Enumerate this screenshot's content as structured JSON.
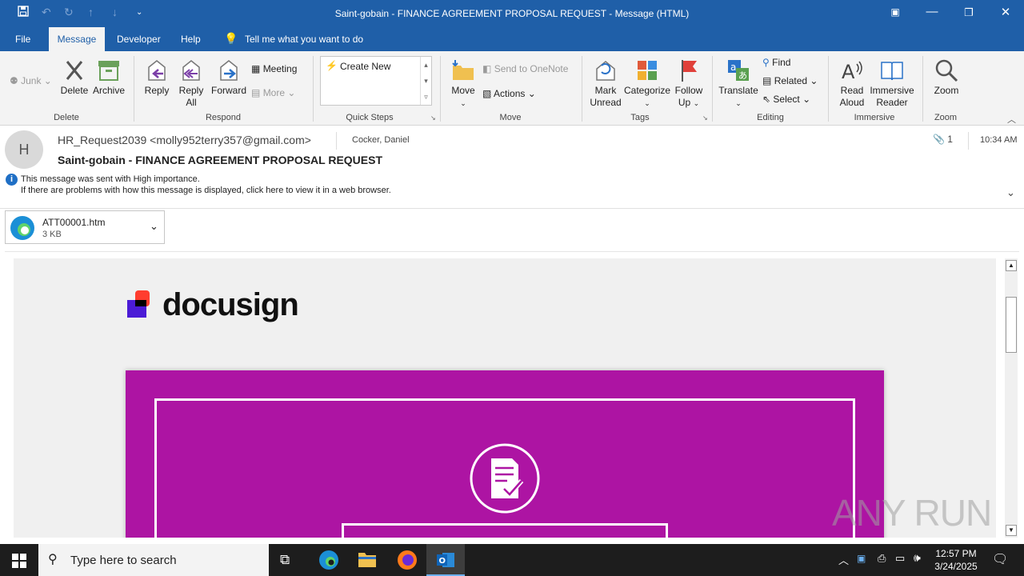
{
  "window": {
    "title": "Saint-gobain - FINANCE AGREEMENT PROPOSAL REQUEST  -  Message (HTML)"
  },
  "menu": {
    "tabs": [
      "File",
      "Message",
      "Developer",
      "Help"
    ],
    "tell_me": "Tell me what you want to do"
  },
  "ribbon": {
    "delete_group": {
      "junk": "Junk",
      "delete": "Delete",
      "archive": "Archive",
      "label": "Delete"
    },
    "respond_group": {
      "reply": "Reply",
      "reply_all_1": "Reply",
      "reply_all_2": "All",
      "forward": "Forward",
      "meeting": "Meeting",
      "more": "More",
      "label": "Respond"
    },
    "quick_steps": {
      "create_new": "Create New",
      "label": "Quick Steps"
    },
    "move_group": {
      "move": "Move",
      "onenote": "Send to OneNote",
      "actions": "Actions",
      "label": "Move"
    },
    "tags_group": {
      "mark_1": "Mark",
      "mark_2": "Unread",
      "categorize": "Categorize",
      "follow_1": "Follow",
      "follow_2": "Up",
      "label": "Tags"
    },
    "editing_group": {
      "translate": "Translate",
      "find": "Find",
      "related": "Related",
      "select": "Select",
      "label": "Editing"
    },
    "immersive_group": {
      "read_1": "Read",
      "read_2": "Aloud",
      "immersive_1": "Immersive",
      "immersive_2": "Reader",
      "label": "Immersive"
    },
    "zoom_group": {
      "zoom": "Zoom",
      "label": "Zoom"
    }
  },
  "message": {
    "avatar_initial": "H",
    "from": "HR_Request2039 <molly952terry357@gmail.com>",
    "to": "Cocker, Daniel",
    "subject": "Saint-gobain - FINANCE AGREEMENT PROPOSAL REQUEST",
    "attachment_count": "1",
    "time": "10:34 AM",
    "info_line_1": "This message was sent with High importance.",
    "info_line_2": "If there are problems with how this message is displayed, click here to view it in a web browser."
  },
  "attachment": {
    "name": "ATT00001.htm",
    "size": "3 KB"
  },
  "email_body": {
    "brand": "docusign",
    "brand_color": "#ad14a3"
  },
  "taskbar": {
    "search_placeholder": "Type here to search",
    "time": "12:57 PM",
    "date": "3/24/2025"
  },
  "watermark": "ANY RUN"
}
